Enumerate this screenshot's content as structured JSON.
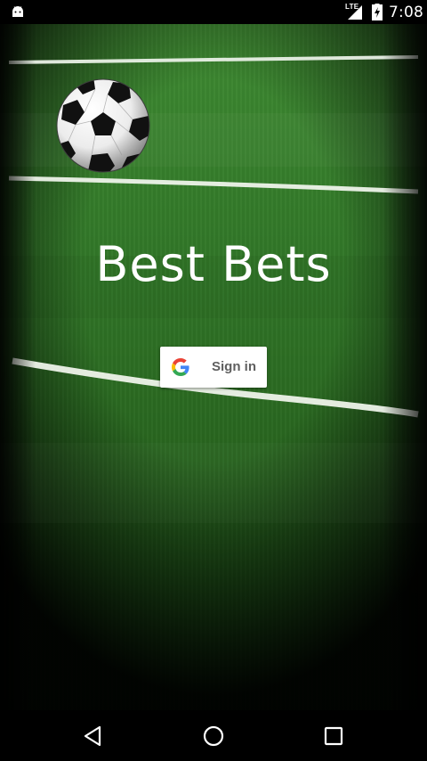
{
  "status_bar": {
    "network_label": "LTE",
    "time": "7:08",
    "icons": {
      "notification": "android-icon",
      "signal": "signal-icon",
      "battery": "battery-charging-icon"
    }
  },
  "app": {
    "title": "Best Bets",
    "background_image": "soccer-field-image",
    "ball_image": "soccer-ball-image",
    "signin_button": {
      "label": "Sign in",
      "icon": "google-g-icon"
    }
  },
  "nav_bar": {
    "back": "back-triangle-icon",
    "home": "home-circle-icon",
    "recents": "recents-square-icon"
  },
  "colors": {
    "field_green": "#2f7326",
    "line_white": "#ffffff",
    "button_bg": "#ffffff",
    "button_text": "#5f5f5f",
    "google_blue": "#4285F4",
    "google_red": "#EA4335",
    "google_yellow": "#FBBC05",
    "google_green": "#34A853"
  }
}
